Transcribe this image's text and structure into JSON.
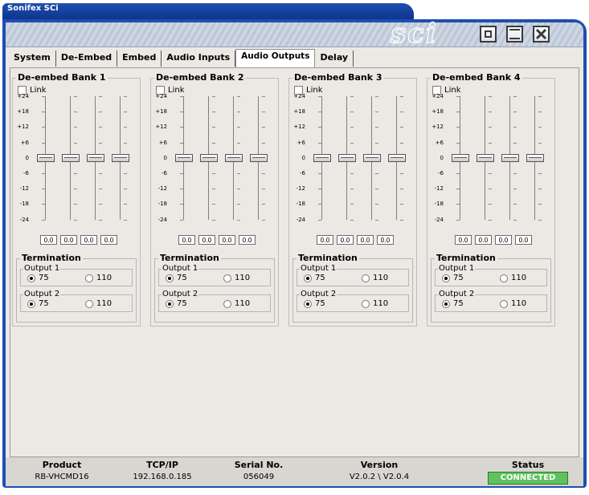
{
  "window": {
    "title": "Sonifex SCi",
    "logo": "sci"
  },
  "tabs": [
    "System",
    "De-Embed",
    "Embed",
    "Audio Inputs",
    "Audio Outputs",
    "Delay"
  ],
  "active_tab": "Audio Outputs",
  "scale": [
    "+24",
    "+18",
    "+12",
    "+6",
    "0",
    "-6",
    "-12",
    "-18",
    "-24"
  ],
  "banks": [
    {
      "title": "De-embed Bank 1",
      "link_label": "Link",
      "values": [
        "0.0",
        "0.0",
        "0.0",
        "0.0"
      ]
    },
    {
      "title": "De-embed Bank 2",
      "link_label": "Link",
      "values": [
        "0.0",
        "0.0",
        "0.0",
        "0.0"
      ]
    },
    {
      "title": "De-embed Bank 3",
      "link_label": "Link",
      "values": [
        "0.0",
        "0.0",
        "0.0",
        "0.0"
      ]
    },
    {
      "title": "De-embed Bank 4",
      "link_label": "Link",
      "values": [
        "0.0",
        "0.0",
        "0.0",
        "0.0"
      ]
    }
  ],
  "termination": {
    "title": "Termination",
    "outputs": [
      "Output 1",
      "Output 2"
    ],
    "options": [
      "75",
      "110"
    ],
    "selected": "75"
  },
  "status_bar": {
    "product_label": "Product",
    "product_value": "RB-VHCMD16",
    "tcpip_label": "TCP/IP",
    "tcpip_value": "192.168.0.185",
    "serial_label": "Serial No.",
    "serial_value": "056049",
    "version_label": "Version",
    "version_value": "V2.0.2 \\ V2.0.4",
    "status_label": "Status",
    "status_value": "CONNECTED"
  },
  "colors": {
    "title_bar": "#1d4fb0",
    "status_ok": "#5fc25f",
    "panel": "#ece9e4"
  }
}
